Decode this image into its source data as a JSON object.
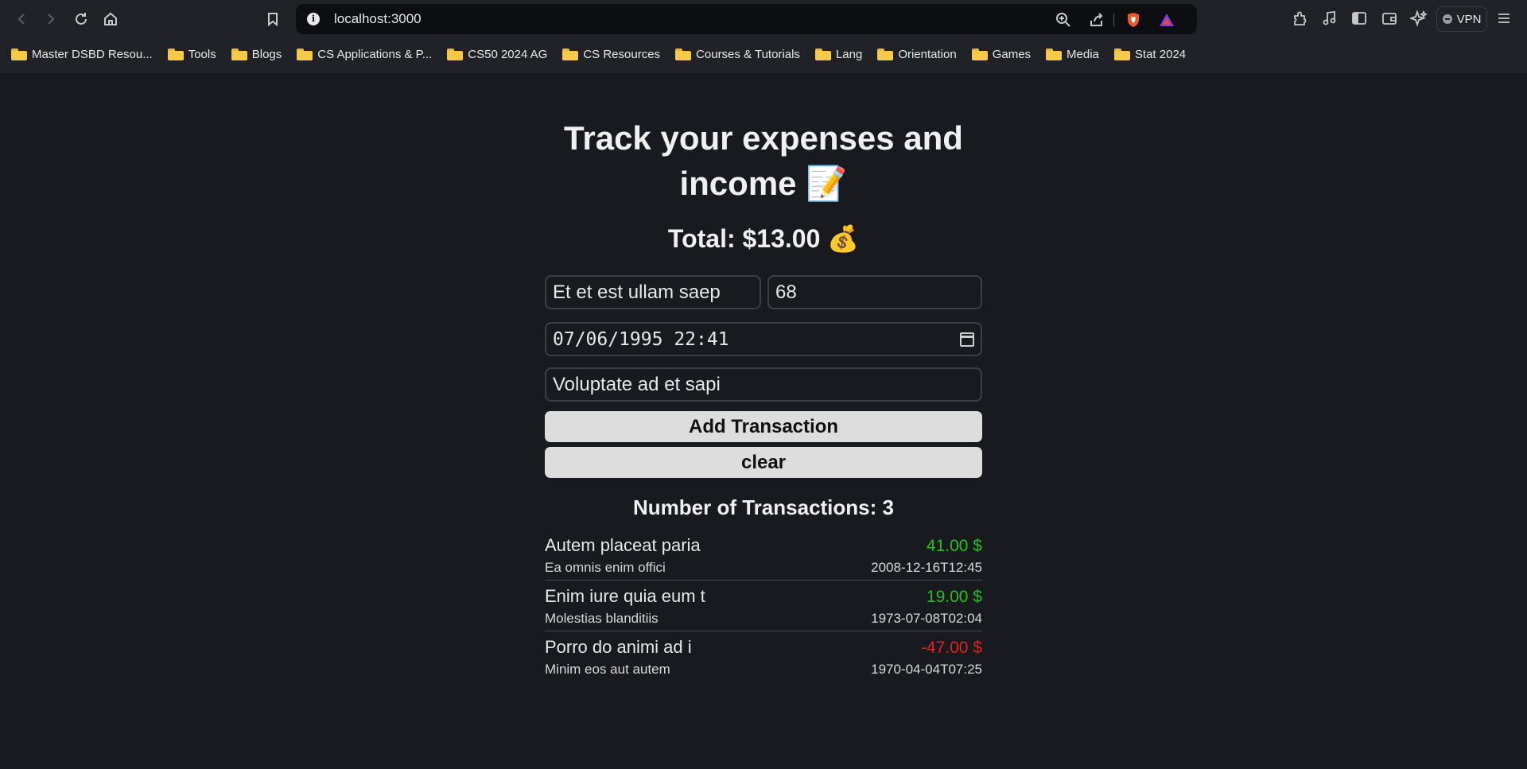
{
  "browser": {
    "url": "localhost:3000",
    "vpn_label": "VPN",
    "bookmarks": [
      "Master DSBD Resou...",
      "Tools",
      "Blogs",
      "CS Applications & P...",
      "CS50 2024 AG",
      "CS Resources",
      "Courses & Tutorials",
      "Lang",
      "Orientation",
      "Games",
      "Media",
      "Stat 2024"
    ]
  },
  "app": {
    "title_line1": "Track your expenses and",
    "title_line2": "income 📝",
    "total": "Total: $13.00 💰",
    "form": {
      "name_value": "Et et est ullam saep",
      "amount_value": "68",
      "datetime_value": "07/06/1995 22:41",
      "description_value": "Voluptate ad et sapi"
    },
    "add_button": "Add Transaction",
    "clear_button": "clear",
    "count_label": "Number of Transactions: 3",
    "transactions": [
      {
        "name": "Autem placeat paria",
        "amount": "41.00 $",
        "type": "positive",
        "description": "Ea omnis enim offici",
        "date": "2008-12-16T12:45"
      },
      {
        "name": "Enim iure quia eum t",
        "amount": "19.00 $",
        "type": "positive",
        "description": "Molestias blanditiis",
        "date": "1973-07-08T02:04"
      },
      {
        "name": "Porro do animi ad i",
        "amount": "-47.00 $",
        "type": "negative",
        "description": "Minim eos aut autem",
        "date": "1970-04-04T07:25"
      }
    ]
  },
  "colors": {
    "positive": "#22c21c",
    "negative": "#e0231c",
    "background": "#191a20"
  }
}
